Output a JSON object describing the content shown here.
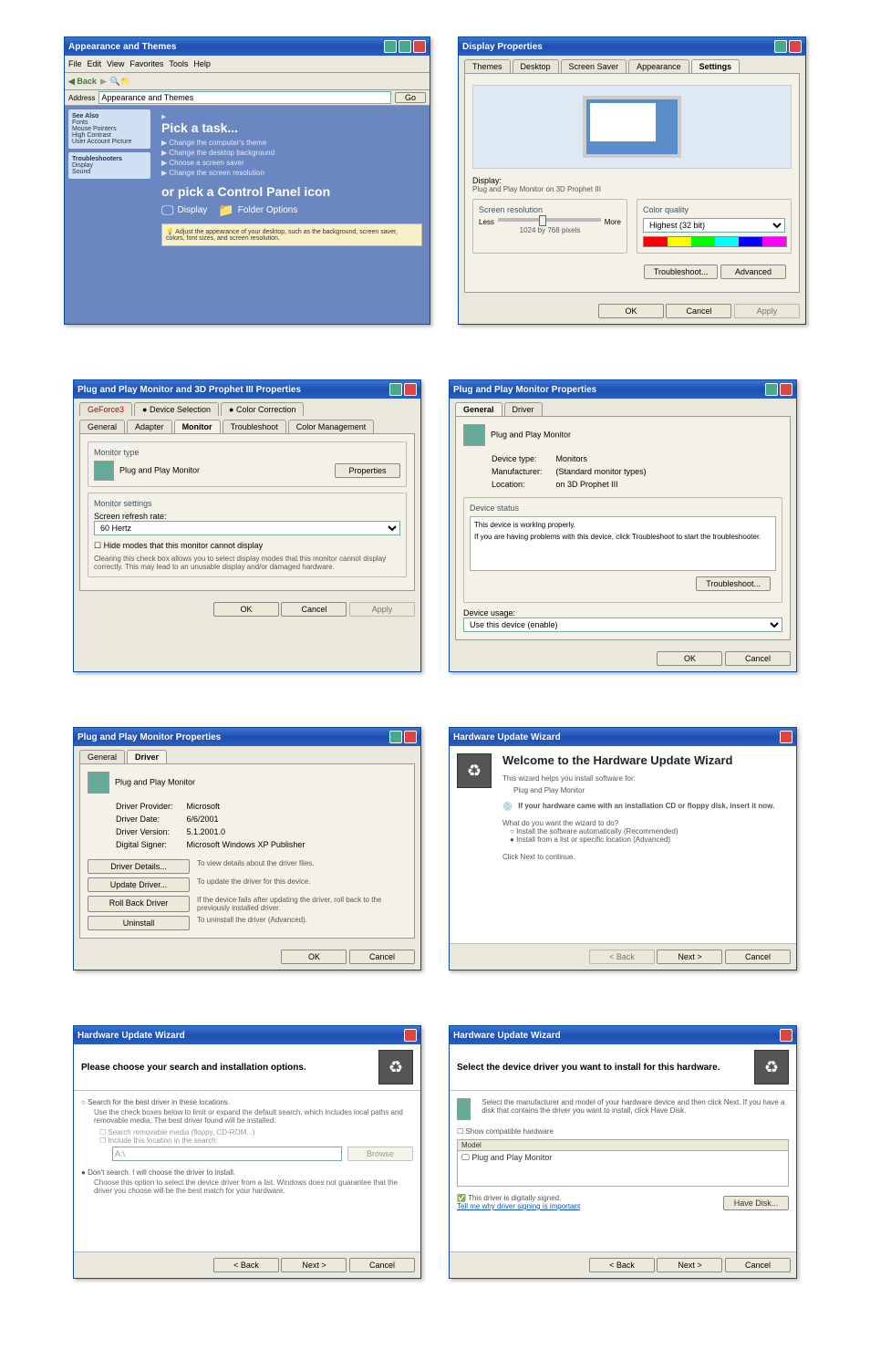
{
  "controlPanel": {
    "title": "Appearance and Themes",
    "menu": [
      "File",
      "Edit",
      "View",
      "Favorites",
      "Tools",
      "Help"
    ],
    "back": "Back",
    "address": "Address",
    "addressValue": "Appearance and Themes",
    "go": "Go",
    "sideSeeAlso": "See Also",
    "sideItems": [
      "Fonts",
      "Mouse Pointers",
      "High Contrast",
      "User Account Picture"
    ],
    "sideTrouble": "Troubleshooters",
    "sideTroubleItems": [
      "Display",
      "Sound"
    ],
    "pickTask": "Pick a task...",
    "tasks": [
      "Change the computer's theme",
      "Change the desktop background",
      "Choose a screen saver",
      "Change the screen resolution"
    ],
    "orPick": "or pick a Control Panel icon",
    "icons": [
      "Display",
      "Folder Options"
    ],
    "tip": "Adjust the appearance of your desktop, such as the background, screen saver, colors, font sizes, and screen resolution."
  },
  "displayProps": {
    "title": "Display Properties",
    "tabs": [
      "Themes",
      "Desktop",
      "Screen Saver",
      "Appearance",
      "Settings"
    ],
    "displayGroup": "Display:",
    "displayText": "Plug and Play Monitor on 3D Prophet III",
    "resGroup": "Screen resolution",
    "less": "Less",
    "more": "More",
    "resValue": "1024 by 768 pixels",
    "colorGroup": "Color quality",
    "colorValue": "Highest (32 bit)",
    "troubleshoot": "Troubleshoot...",
    "advanced": "Advanced",
    "ok": "OK",
    "cancel": "Cancel",
    "apply": "Apply"
  },
  "advProps": {
    "title": "Plug and Play Monitor and 3D Prophet III Properties",
    "tabs1": [
      "GeForce3",
      "Device Selection",
      "Color Correction"
    ],
    "tabs2": [
      "General",
      "Adapter",
      "Monitor",
      "Troubleshoot",
      "Color Management"
    ],
    "monTypeGroup": "Monitor type",
    "monType": "Plug and Play Monitor",
    "properties": "Properties",
    "monSettings": "Monitor settings",
    "refreshLabel": "Screen refresh rate:",
    "refreshValue": "60 Hertz",
    "hideModes": "Hide modes that this monitor cannot display",
    "hideDesc": "Clearing this check box allows you to select display modes that this monitor cannot display correctly. This may lead to an unusable display and/or damaged hardware.",
    "ok": "OK",
    "cancel": "Cancel",
    "apply": "Apply"
  },
  "monProps": {
    "title": "Plug and Play Monitor Properties",
    "tabs": [
      "General",
      "Driver"
    ],
    "name": "Plug and Play Monitor",
    "devType": "Device type:",
    "devTypeVal": "Monitors",
    "manuf": "Manufacturer:",
    "manufVal": "(Standard monitor types)",
    "loc": "Location:",
    "locVal": "on 3D Prophet III",
    "statusGroup": "Device status",
    "statusText": "This device is working properly.",
    "statusHelp": "If you are having problems with this device, click Troubleshoot to start the troubleshooter.",
    "troubleshoot": "Troubleshoot...",
    "usage": "Device usage:",
    "usageVal": "Use this device (enable)",
    "ok": "OK",
    "cancel": "Cancel"
  },
  "monDriver": {
    "title": "Plug and Play Monitor Properties",
    "tabs": [
      "General",
      "Driver"
    ],
    "name": "Plug and Play Monitor",
    "prov": "Driver Provider:",
    "provVal": "Microsoft",
    "date": "Driver Date:",
    "dateVal": "6/6/2001",
    "ver": "Driver Version:",
    "verVal": "5.1.2001.0",
    "signer": "Digital Signer:",
    "signerVal": "Microsoft Windows XP Publisher",
    "details": "Driver Details...",
    "detailsDesc": "To view details about the driver files.",
    "update": "Update Driver...",
    "updateDesc": "To update the driver for this device.",
    "rollback": "Roll Back Driver",
    "rollbackDesc": "If the device fails after updating the driver, roll back to the previously installed driver.",
    "uninstall": "Uninstall",
    "uninstallDesc": "To uninstall the driver (Advanced).",
    "ok": "OK",
    "cancel": "Cancel"
  },
  "wiz1": {
    "title": "Hardware Update Wizard",
    "welcome": "Welcome to the Hardware Update Wizard",
    "helps": "This wizard helps you install software for:",
    "device": "Plug and Play Monitor",
    "cd": "If your hardware came with an installation CD or floppy disk, insert it now.",
    "what": "What do you want the wizard to do?",
    "opt1": "Install the software automatically (Recommended)",
    "opt2": "Install from a list or specific location (Advanced)",
    "click": "Click Next to continue.",
    "back": "< Back",
    "next": "Next >",
    "cancel": "Cancel"
  },
  "wiz2": {
    "title": "Hardware Update Wizard",
    "heading": "Please choose your search and installation options.",
    "opt1": "Search for the best driver in these locations.",
    "opt1desc": "Use the check boxes below to limit or expand the default search, which includes local paths and removable media. The best driver found will be installed.",
    "chk1": "Search removable media (floppy, CD-ROM...)",
    "chk2": "Include this location in the search:",
    "pathVal": "A:\\",
    "browse": "Browse",
    "opt2": "Don't search. I will choose the driver to install.",
    "opt2desc": "Choose this option to select the device driver from a list. Windows does not guarantee that the driver you choose will be the best match for your hardware.",
    "back": "< Back",
    "next": "Next >",
    "cancel": "Cancel"
  },
  "wiz3": {
    "title": "Hardware Update Wizard",
    "heading": "Select the device driver you want to install for this hardware.",
    "desc": "Select the manufacturer and model of your hardware device and then click Next. If you have a disk that contains the driver you want to install, click Have Disk.",
    "showCompat": "Show compatible hardware",
    "model": "Model",
    "item": "Plug and Play Monitor",
    "signed": "This driver is digitally signed.",
    "tell": "Tell me why driver signing is important",
    "haveDisk": "Have Disk...",
    "back": "< Back",
    "next": "Next >",
    "cancel": "Cancel"
  }
}
